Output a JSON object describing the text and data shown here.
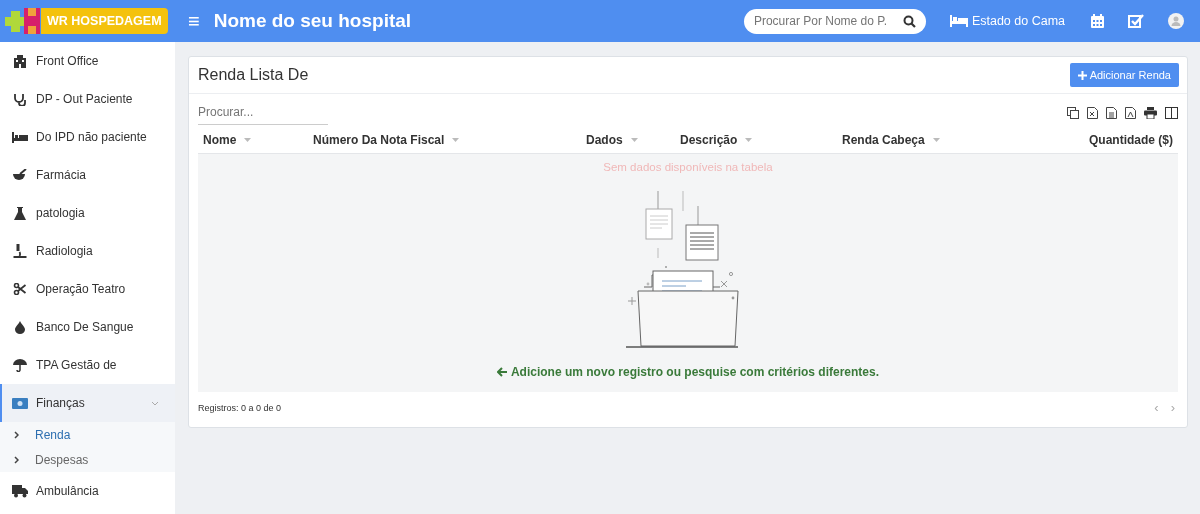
{
  "header": {
    "logo": "WR HOSPEDAGEM",
    "menu_glyph": "≡",
    "title": "Nome do seu hospital",
    "search": {
      "placeholder": "Procurar Por Nome do P."
    },
    "bed_status": "Estado do Cama"
  },
  "sidebar": {
    "items": [
      {
        "label": "Front Office",
        "selected": false
      },
      {
        "label": "DP - Out Paciente",
        "selected": false
      },
      {
        "label": "Do IPD não paciente",
        "selected": false
      },
      {
        "label": "Farmácia",
        "selected": false
      },
      {
        "label": "patologia",
        "selected": false
      },
      {
        "label": "Radiologia",
        "selected": false
      },
      {
        "label": "Operação Teatro",
        "selected": false
      },
      {
        "label": "Banco De Sangue",
        "selected": false
      },
      {
        "label": "TPA Gestão de",
        "selected": false
      },
      {
        "label": "Finanças",
        "selected": true,
        "expanded": true,
        "children": [
          {
            "label": "Renda",
            "selected": true
          },
          {
            "label": "Despesas",
            "selected": false
          }
        ]
      },
      {
        "label": "Ambulância",
        "selected": false
      }
    ]
  },
  "card": {
    "title": "Renda Lista De",
    "add_button": "Adicionar Renda",
    "search": {
      "placeholder": "Procurar..."
    },
    "table": {
      "columns": [
        {
          "label": "Nome",
          "sortable": true
        },
        {
          "label": "Número Da Nota Fiscal",
          "sortable": true
        },
        {
          "label": "Dados",
          "sortable": true
        },
        {
          "label": "Descrição",
          "sortable": true
        },
        {
          "label": "Renda Cabeça",
          "sortable": true
        },
        {
          "label": "Quantidade ($)",
          "sortable": false
        }
      ],
      "empty_message": "Sem dados disponíveis na tabela",
      "hint": "Adicione um novo registro ou pesquise com critérios diferentes."
    },
    "records": "Registros: 0 a 0 de 0",
    "pager": [
      "‹",
      "›"
    ]
  }
}
